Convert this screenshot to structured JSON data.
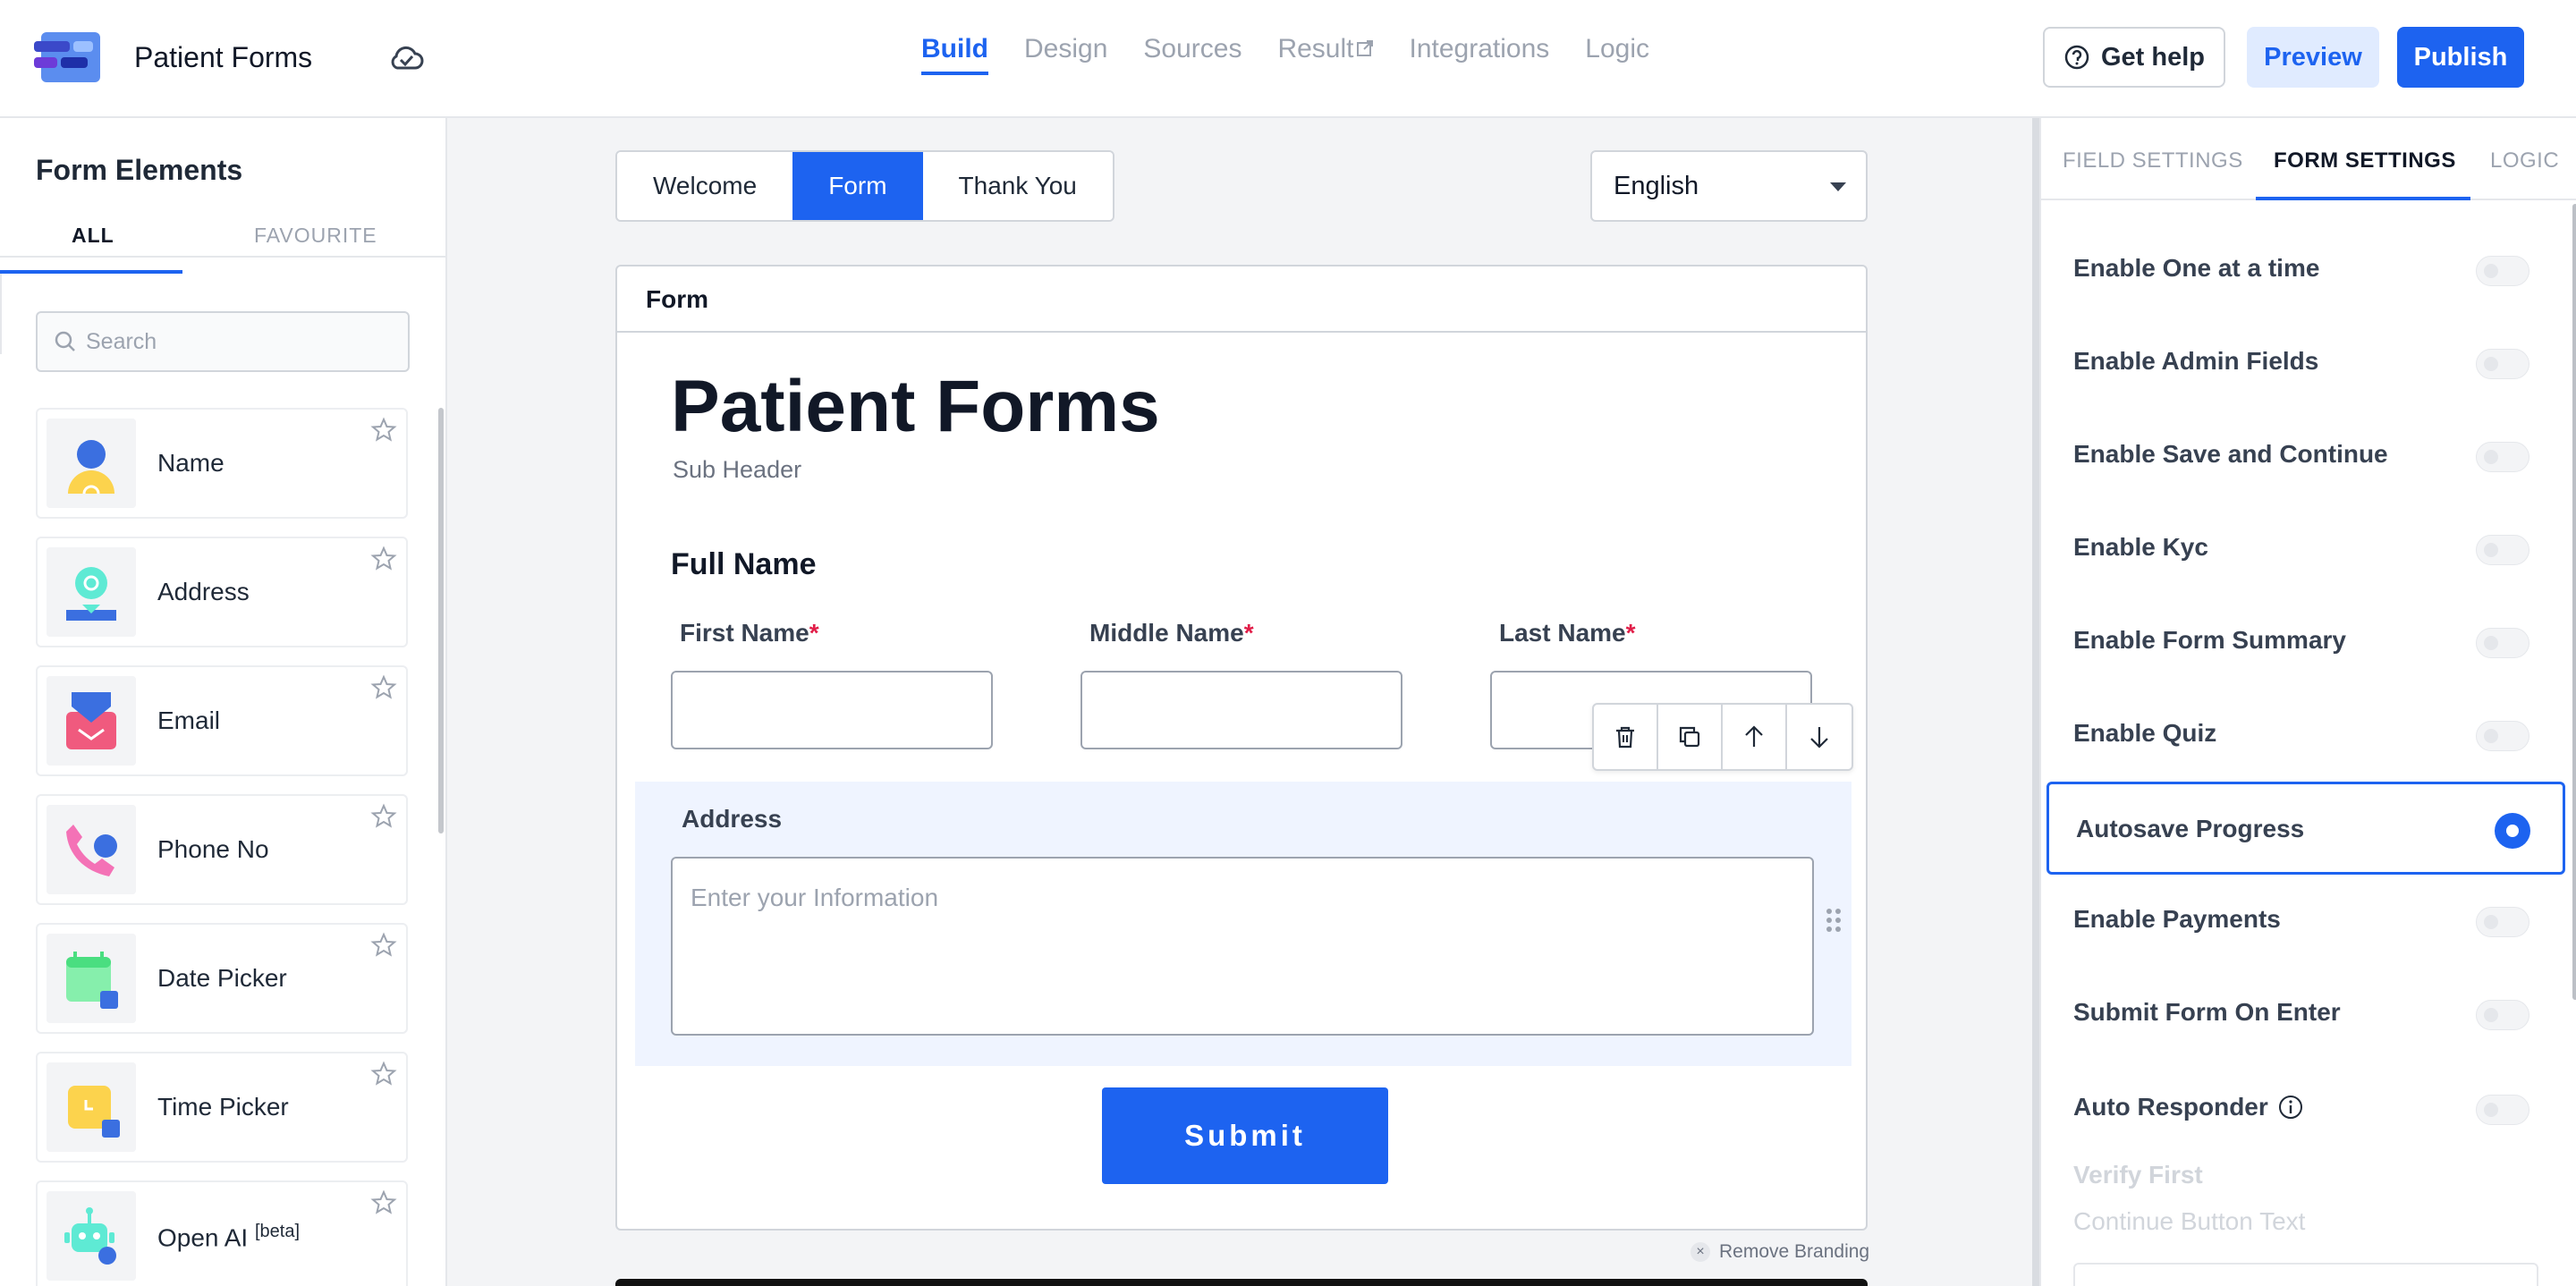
{
  "header": {
    "app_title": "Patient Forms",
    "nav": [
      "Build",
      "Design",
      "Sources",
      "Result",
      "Integrations",
      "Logic"
    ],
    "get_help": "Get help",
    "preview": "Preview",
    "publish": "Publish",
    "accent": "#1d63f0"
  },
  "left": {
    "title": "Form Elements",
    "tabs": [
      "ALL",
      "FAVOURITE"
    ],
    "search_placeholder": "Search",
    "elements": [
      {
        "label": "Name",
        "icon": "person-icon"
      },
      {
        "label": "Address",
        "icon": "location-icon"
      },
      {
        "label": "Email",
        "icon": "envelope-icon"
      },
      {
        "label": "Phone No",
        "icon": "phone-icon"
      },
      {
        "label": "Date Picker",
        "icon": "calendar-icon"
      },
      {
        "label": "Time Picker",
        "icon": "clock-icon"
      },
      {
        "label": "Open AI",
        "badge": "[beta]",
        "icon": "robot-icon"
      }
    ]
  },
  "canvas": {
    "page_tabs": [
      "Welcome",
      "Form",
      "Thank You"
    ],
    "language": "English",
    "card_header": "Form",
    "form_title": "Patient Forms",
    "sub_header": "Sub Header",
    "section_title": "Full Name",
    "fields": [
      {
        "label": "First Name",
        "required": "*"
      },
      {
        "label": "Middle Name",
        "required": "*"
      },
      {
        "label": "Last Name",
        "required": "*"
      }
    ],
    "address_label": "Address",
    "address_placeholder": "Enter your Information",
    "submit": "Submit",
    "remove_branding": "Remove Branding"
  },
  "right": {
    "tabs": [
      "FIELD SETTINGS",
      "FORM SETTINGS",
      "LOGIC"
    ],
    "settings": [
      {
        "label": "Enable One at a time",
        "on": false
      },
      {
        "label": "Enable Admin Fields",
        "on": false
      },
      {
        "label": "Enable Save and Continue",
        "on": false
      },
      {
        "label": "Enable Kyc",
        "on": false
      },
      {
        "label": "Enable Form Summary",
        "on": false
      },
      {
        "label": "Enable Quiz",
        "on": false
      },
      {
        "label": "Autosave Progress",
        "on": true
      },
      {
        "label": "Enable Payments",
        "on": false
      },
      {
        "label": "Submit Form On Enter",
        "on": false
      },
      {
        "label": "Auto Responder",
        "on": false
      }
    ],
    "verify_first": "Verify First",
    "continue_button_text": "Continue Button Text"
  }
}
